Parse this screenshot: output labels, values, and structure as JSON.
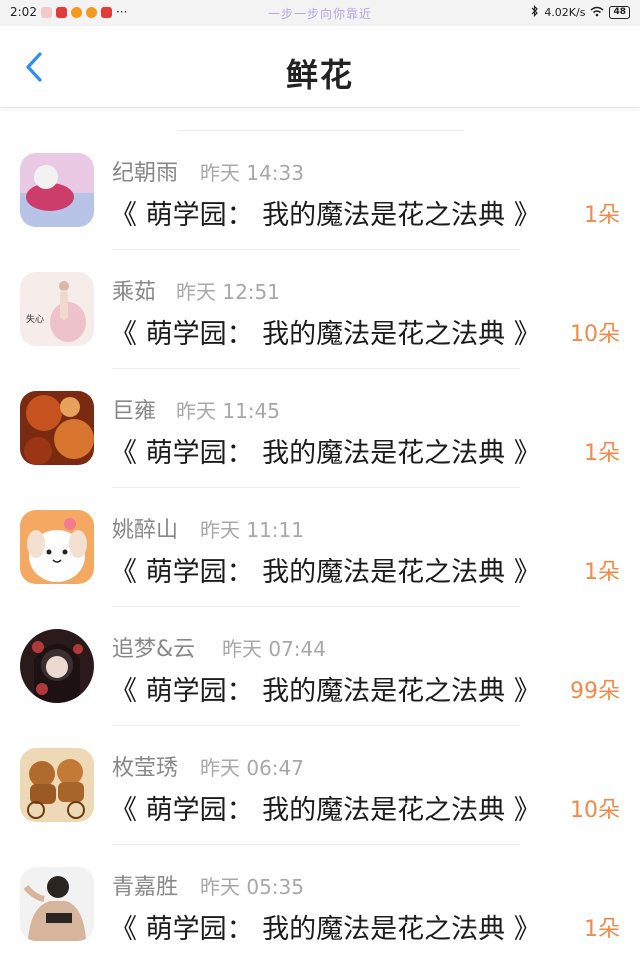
{
  "status_bar": {
    "time": "2:02",
    "center_text": "一步一步向你靠近",
    "network_speed": "4.02K/s",
    "battery": "48"
  },
  "header": {
    "title": "鲜花",
    "back_icon": "chevron-left-icon"
  },
  "gifts": [
    {
      "name": "纪朝雨",
      "time": "昨天 14:33",
      "book": "《 萌学园：  我的魔法是花之法典 》",
      "amount": "1朵",
      "avatar_colors": [
        "#e9c9e4",
        "#cc3d6a"
      ],
      "avatar_shape": "rounded"
    },
    {
      "name": "乘茹",
      "time": "昨天 12:51",
      "book": "《 萌学园：  我的魔法是花之法典 》",
      "amount": "10朵",
      "avatar_colors": [
        "#f6ecea",
        "#e8a7b5"
      ],
      "avatar_shape": "rounded",
      "avatar_text": "失心"
    },
    {
      "name": "巨雍",
      "time": "昨天 11:45",
      "book": "《 萌学园：  我的魔法是花之法典 》",
      "amount": "1朵",
      "avatar_colors": [
        "#c6521f",
        "#7a2a10"
      ],
      "avatar_shape": "rounded"
    },
    {
      "name": "姚醉山",
      "time": "昨天 11:11",
      "book": "《 萌学园：  我的魔法是花之法典 》",
      "amount": "1朵",
      "avatar_colors": [
        "#f4a862",
        "#ffffff"
      ],
      "avatar_shape": "rounded"
    },
    {
      "name": "追梦&云",
      "time": "昨天 07:44",
      "book": "《 萌学园：  我的魔法是花之法典 》",
      "amount": "99朵",
      "avatar_colors": [
        "#2a1a1c",
        "#b2393b"
      ],
      "avatar_shape": "round"
    },
    {
      "name": "枚莹琇",
      "time": "昨天 06:47",
      "book": "《 萌学园：  我的魔法是花之法典 》",
      "amount": "10朵",
      "avatar_colors": [
        "#eed9b6",
        "#b06a2e"
      ],
      "avatar_shape": "rounded"
    },
    {
      "name": "青嘉胜",
      "time": "昨天 05:35",
      "book": "《 萌学园：  我的魔法是花之法典 》",
      "amount": "1朵",
      "avatar_colors": [
        "#f2f2f2",
        "#2b2522"
      ],
      "avatar_shape": "rounded"
    }
  ],
  "colors": {
    "accent_blue": "#2f8ef0",
    "flower_orange": "#f08a4b",
    "name_gray": "#888888",
    "time_gray": "#a8a8a8"
  }
}
